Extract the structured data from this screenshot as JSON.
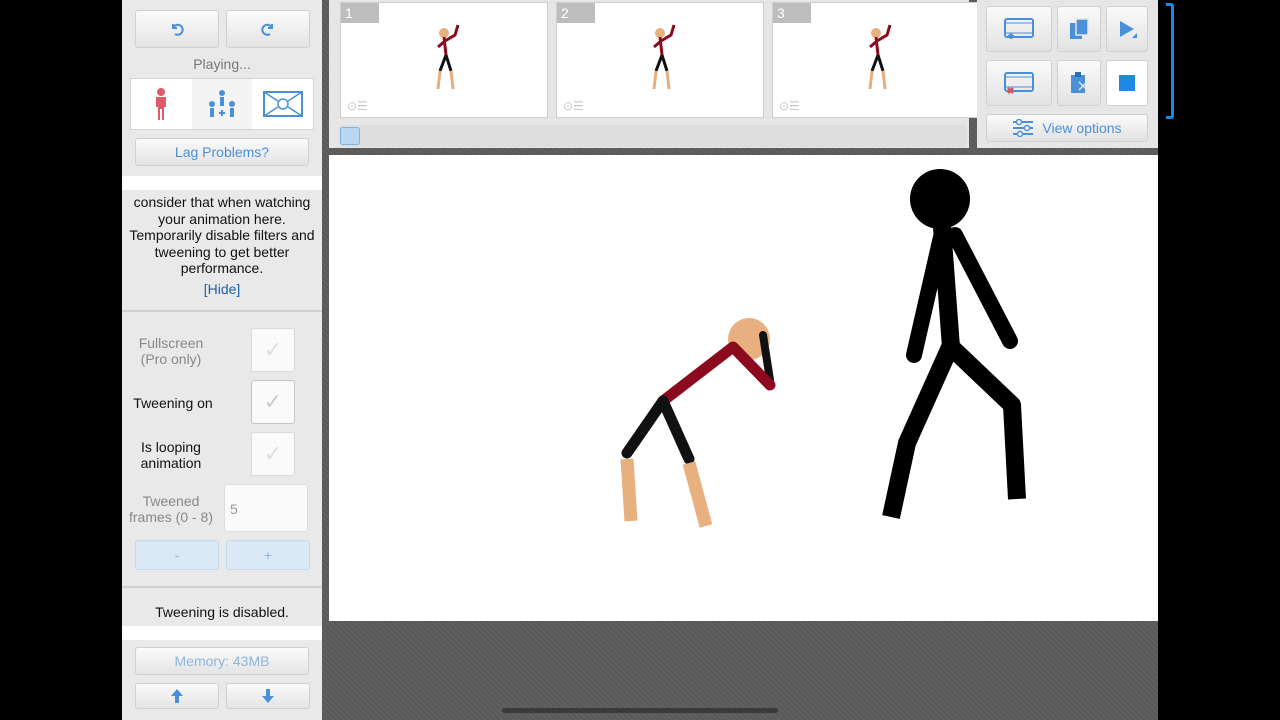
{
  "status": {
    "playing": "Playing..."
  },
  "buttons": {
    "undo_icon": "undo-icon",
    "redo_icon": "redo-icon",
    "lag": "Lag Problems?",
    "memory": "Memory: 43MB"
  },
  "hint": {
    "text": "consider that when watching your animation here. Temporarily disable filters and tweening to get better performance.",
    "hide": "[Hide]"
  },
  "options": {
    "fullscreen": "Fullscreen\n(Pro only)",
    "tweening": "Tweening on",
    "looping": "Is looping animation",
    "tweened_frames": "Tweened frames (0 - 8)",
    "tweened_value": "5",
    "minus": "-",
    "plus": "+",
    "tween_status": "Tweening is disabled."
  },
  "frames": [
    {
      "number": "1"
    },
    {
      "number": "2"
    },
    {
      "number": "3"
    }
  ],
  "tools": {
    "view_options": "View options"
  },
  "colors": {
    "accent": "#4a90d9",
    "selection": "#1e88e5",
    "figure_red": "#8b0a1e",
    "skin": "#e8b07f"
  }
}
